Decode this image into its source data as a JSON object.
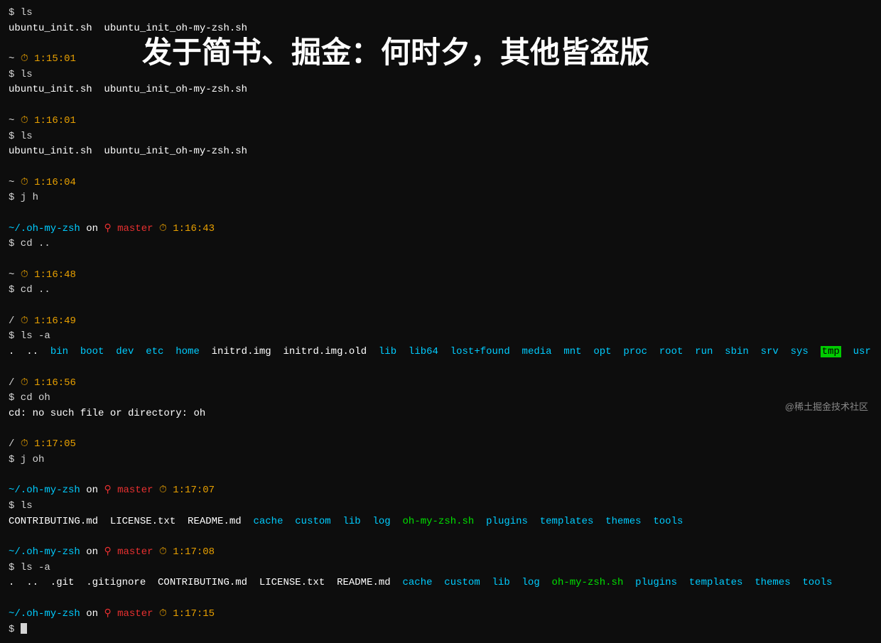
{
  "overlay": {
    "text": "发于简书、掘金：何时夕，其他皆盗版"
  },
  "watermark": "@稀土掘金技术社区",
  "terminal": {
    "lines": [
      {
        "type": "cmd",
        "content": "$ ls"
      },
      {
        "type": "output",
        "content": "ubuntu_init.sh   ubuntu_init_oh-my-zsh.sh"
      },
      {
        "type": "blank"
      },
      {
        "type": "prompt-time",
        "tilde": "~",
        "time": "1:15:01"
      },
      {
        "type": "cmd",
        "content": "$ ls"
      },
      {
        "type": "output",
        "content": "ubuntu_init.sh   ubuntu_init_oh-my-zsh.sh"
      },
      {
        "type": "blank"
      },
      {
        "type": "prompt-time",
        "tilde": "~",
        "time": "1:16:01"
      },
      {
        "type": "cmd",
        "content": "$ ls"
      },
      {
        "type": "output",
        "content": "ubuntu_init.sh   ubuntu_init_oh-my-zsh.sh"
      },
      {
        "type": "blank"
      },
      {
        "type": "prompt-time",
        "tilde": "~",
        "time": "1:16:04"
      },
      {
        "type": "cmd",
        "content": "$ j h"
      },
      {
        "type": "blank"
      },
      {
        "type": "prompt-git-time",
        "path": "~/.oh-my-zsh",
        "on": "on",
        "branch": "master",
        "time": "1:16:43"
      },
      {
        "type": "cmd",
        "content": "$ cd .."
      },
      {
        "type": "blank"
      },
      {
        "type": "prompt-time",
        "tilde": "~",
        "time": "1:16:48"
      },
      {
        "type": "cmd",
        "content": "$ cd .."
      },
      {
        "type": "blank"
      },
      {
        "type": "prompt-time",
        "tilde": "/",
        "time": "1:16:49"
      },
      {
        "type": "cmd",
        "content": "$ ls -a"
      },
      {
        "type": "ls-output",
        "content": ".   ..   bin   boot   dev   etc   home   initrd.img   initrd.img.old   lib   lib64   lost+found   media   mnt   opt   proc   root   run   sbin   srv   sys   tmp   usr   var   vmlinuz   vmlinuz.old"
      },
      {
        "type": "blank"
      },
      {
        "type": "prompt-time",
        "tilde": "/",
        "time": "1:16:56"
      },
      {
        "type": "cmd",
        "content": "$ cd oh"
      },
      {
        "type": "output",
        "content": "cd: no such file or directory: oh"
      },
      {
        "type": "blank"
      },
      {
        "type": "prompt-time",
        "tilde": "/",
        "time": "1:17:05"
      },
      {
        "type": "cmd",
        "content": "$ j oh"
      },
      {
        "type": "blank"
      },
      {
        "type": "prompt-git-time",
        "path": "~/.oh-my-zsh",
        "on": "on",
        "branch": "master",
        "time": "1:17:07"
      },
      {
        "type": "cmd",
        "content": "$ ls"
      },
      {
        "type": "output2",
        "content": "CONTRIBUTING.md   LICENSE.txt   README.md   cache   custom   lib   log   oh-my-zsh.sh   plugins   templates   themes   tools"
      },
      {
        "type": "blank"
      },
      {
        "type": "prompt-git-time",
        "path": "~/.oh-my-zsh",
        "on": "on",
        "branch": "master",
        "time": "1:17:08"
      },
      {
        "type": "cmd",
        "content": "$ ls -a"
      },
      {
        "type": "output3",
        "content": ".   ..   .git   .gitignore   CONTRIBUTING.md   LICENSE.txt   README.md   cache   custom   lib   log   oh-my-zsh.sh   plugins   templates   themes   tools"
      },
      {
        "type": "blank"
      },
      {
        "type": "prompt-git-time",
        "path": "~/.oh-my-zsh",
        "on": "on",
        "branch": "master",
        "time": "1:17:15"
      },
      {
        "type": "cursor-line"
      }
    ]
  }
}
